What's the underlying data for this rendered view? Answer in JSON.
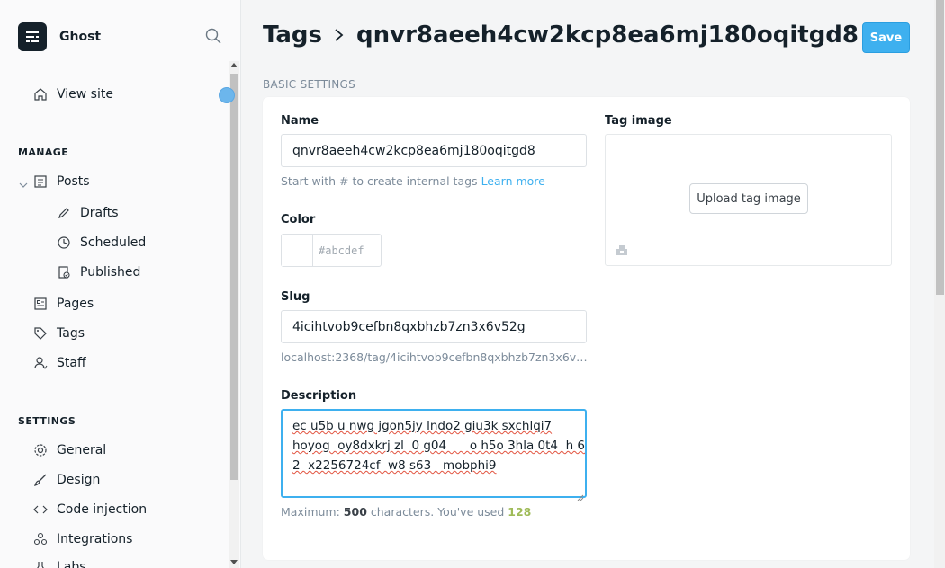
{
  "brand": {
    "name": "Ghost"
  },
  "sidebar": {
    "view_site": "View site",
    "manage_label": "MANAGE",
    "settings_label": "SETTINGS",
    "manage_items": [
      {
        "label": "Posts",
        "icon": "posts-icon"
      },
      {
        "label": "Drafts",
        "icon": "pencil-icon"
      },
      {
        "label": "Scheduled",
        "icon": "clock-icon"
      },
      {
        "label": "Published",
        "icon": "published-icon"
      },
      {
        "label": "Pages",
        "icon": "pages-icon"
      },
      {
        "label": "Tags",
        "icon": "tag-icon"
      },
      {
        "label": "Staff",
        "icon": "staff-icon"
      }
    ],
    "settings_items": [
      {
        "label": "General",
        "icon": "gear-icon"
      },
      {
        "label": "Design",
        "icon": "brush-icon"
      },
      {
        "label": "Code injection",
        "icon": "code-icon"
      },
      {
        "label": "Integrations",
        "icon": "integrations-icon"
      },
      {
        "label": "Labs",
        "icon": "labs-icon"
      }
    ]
  },
  "header": {
    "breadcrumb_root": "Tags",
    "breadcrumb_current": "qnvr8aeeh4cw2kcp8ea6mj180oqitgd8",
    "save_label": "Save"
  },
  "form": {
    "section_title": "BASIC SETTINGS",
    "name_label": "Name",
    "name_value": "qnvr8aeeh4cw2kcp8ea6mj180oqitgd8",
    "name_hint": "Start with # to create internal tags",
    "learn_more": "Learn more",
    "color_label": "Color",
    "color_placeholder": "#abcdef",
    "slug_label": "Slug",
    "slug_value": "4icihtvob9cefbn8qxbhzb7zn3x6v52g",
    "slug_url": "localhost:2368/tag/4icihtvob9cefbn8qxbhzb7zn3x6v…",
    "description_label": "Description",
    "description_lines": [
      "ec u5b u  nwg jgon5jy lndo2 giu3k sxchlqi7",
      "hoyog  oy8dxkrj zl  0 g04      o h5o 3hla 0t4  h 6",
      "2  x2256724cf  w8 s63   mobphi9"
    ],
    "counter_prefix": "Maximum:",
    "counter_max": "500",
    "counter_mid": "characters. You've used",
    "counter_used": "128",
    "tag_image_label": "Tag image",
    "upload_label": "Upload tag image"
  },
  "colors": {
    "accent": "#3eb0ef",
    "ok": "#9fbb58"
  }
}
